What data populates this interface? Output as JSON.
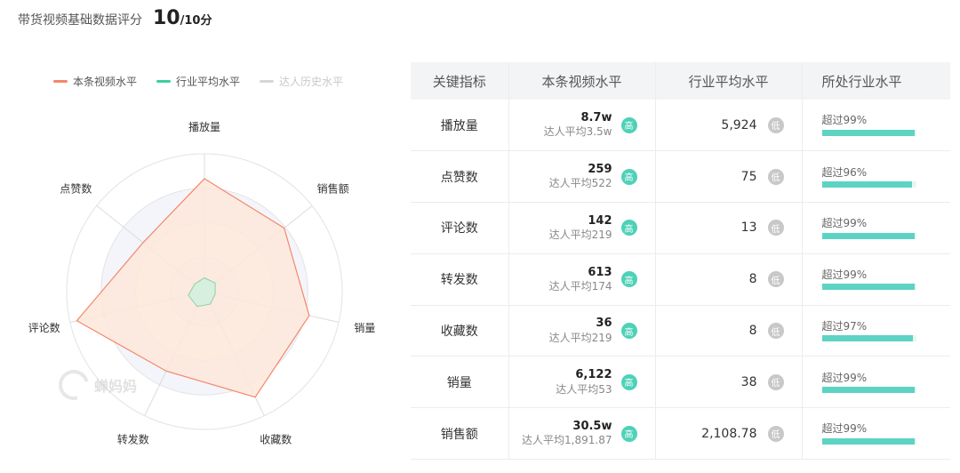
{
  "header": {
    "label": "带货视频基础数据评分",
    "score": "10",
    "total": "/10分"
  },
  "legend": [
    {
      "label": "本条视频水平",
      "color": "#f5866a"
    },
    {
      "label": "行业平均水平",
      "color": "#3ecf9a"
    },
    {
      "label": "达人历史水平",
      "color": "#d6d6d6"
    }
  ],
  "watermark": "蝉妈妈",
  "radar": {
    "axes": [
      "播放量",
      "销售额",
      "销量",
      "收藏数",
      "转发数",
      "评论数",
      "点赞数"
    ],
    "self": [
      0.82,
      0.74,
      0.78,
      0.85,
      0.64,
      0.95,
      0.57
    ],
    "industry": [
      0.1,
      0.1,
      0.08,
      0.1,
      0.12,
      0.12,
      0.09
    ],
    "colors": {
      "self_fill": "#fde7da",
      "self_stroke": "#f5866a",
      "industry_fill": "#d3f0de",
      "industry_stroke": "#8fcf9f"
    }
  },
  "table": {
    "headers": [
      "关键指标",
      "本条视频水平",
      "行业平均水平",
      "所处行业水平"
    ],
    "rows": [
      {
        "name": "播放量",
        "self": "8.7w",
        "self_sub": "达人平均3.5w",
        "self_badge": "高",
        "avg": "5,924",
        "avg_badge": "低",
        "rank": "超过99%",
        "rank_pct": 0.99
      },
      {
        "name": "点赞数",
        "self": "259",
        "self_sub": "达人平均522",
        "self_badge": "高",
        "avg": "75",
        "avg_badge": "低",
        "rank": "超过96%",
        "rank_pct": 0.96
      },
      {
        "name": "评论数",
        "self": "142",
        "self_sub": "达人平均219",
        "self_badge": "高",
        "avg": "13",
        "avg_badge": "低",
        "rank": "超过99%",
        "rank_pct": 0.99
      },
      {
        "name": "转发数",
        "self": "613",
        "self_sub": "达人平均174",
        "self_badge": "高",
        "avg": "8",
        "avg_badge": "低",
        "rank": "超过99%",
        "rank_pct": 0.99
      },
      {
        "name": "收藏数",
        "self": "36",
        "self_sub": "达人平均219",
        "self_badge": "高",
        "avg": "8",
        "avg_badge": "低",
        "rank": "超过97%",
        "rank_pct": 0.97
      },
      {
        "name": "销量",
        "self": "6,122",
        "self_sub": "达人平均53",
        "self_badge": "高",
        "avg": "38",
        "avg_badge": "低",
        "rank": "超过99%",
        "rank_pct": 0.99
      },
      {
        "name": "销售额",
        "self": "30.5w",
        "self_sub": "达人平均1,891.87",
        "self_badge": "高",
        "avg": "2,108.78",
        "avg_badge": "低",
        "rank": "超过99%",
        "rank_pct": 0.99
      }
    ]
  }
}
